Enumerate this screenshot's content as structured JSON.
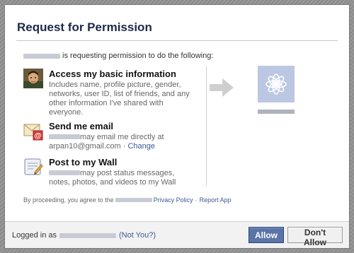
{
  "dialog": {
    "title": "Request for Permission",
    "intro_text": "is requesting permission to do the following:"
  },
  "permissions": [
    {
      "icon": "user-photo-icon",
      "title": "Access my basic information",
      "description": "Includes name, profile picture, gender, networks, user ID, list of friends, and any other information I've shared with everyone."
    },
    {
      "icon": "email-icon",
      "title": "Send me email",
      "description_suffix": "may email me directly at",
      "email": "arpan10@gmail.com",
      "separator": "·",
      "change_label": "Change"
    },
    {
      "icon": "wall-post-icon",
      "title": "Post to my Wall",
      "description_suffix": "may post status messages, notes, photos, and videos to my Wall"
    }
  ],
  "agreement": {
    "prefix": "By proceeding, you agree to the",
    "privacy_policy": "Privacy Policy",
    "separator": "·",
    "report_app": "Report App"
  },
  "footer": {
    "logged_in_as": "Logged in as",
    "not_you": "(Not You?)",
    "allow_label": "Allow",
    "dont_allow_label": "Don't Allow"
  },
  "colors": {
    "allow_button": "#5b74a8",
    "link": "#3b5998",
    "app_icon_bg": "#bcc7e3"
  }
}
